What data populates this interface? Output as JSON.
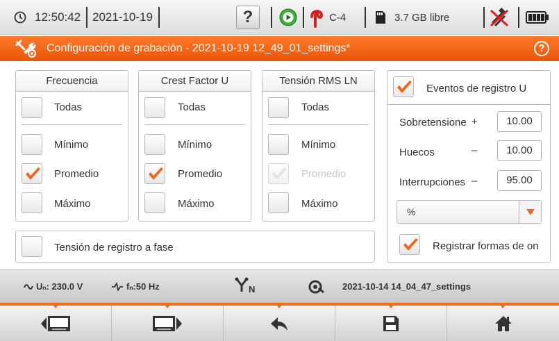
{
  "status": {
    "time": "12:50:42",
    "date": "2021-10-19",
    "help_label": "?",
    "channel": "C-4",
    "storage": "3.7 GB libre",
    "icons": [
      "clock-icon",
      "record-indicator-icon",
      "clamp-icon",
      "sd-card-icon",
      "no-network-icon",
      "battery-icon"
    ]
  },
  "title": {
    "text": "Configuración de grabación - 2021-10-19 12_49_01_settings*",
    "help_label": "?"
  },
  "panels": {
    "frecuencia": {
      "header": "Frecuencia",
      "all": "Todas",
      "min": "Mínimo",
      "avg": "Promedio",
      "max": "Máximo",
      "checked": {
        "all": false,
        "min": false,
        "avg": true,
        "max": false
      }
    },
    "crest": {
      "header": "Crest Factor U",
      "all": "Todas",
      "min": "Mínimo",
      "avg": "Promedio",
      "max": "Máximo",
      "checked": {
        "all": false,
        "min": false,
        "avg": true,
        "max": false
      }
    },
    "rms": {
      "header": "Tensión RMS LN",
      "all": "Todas",
      "min": "Mínimo",
      "avg": "Promedio",
      "max": "Máximo",
      "checked": {
        "all": false,
        "min": false,
        "avg": true,
        "max": false
      },
      "avg_disabled": true
    }
  },
  "phase_voltage": {
    "label": "Tensión de registro a fase",
    "checked": false
  },
  "events": {
    "header": "Eventos de registro U",
    "checked": true,
    "sobretension_label": "Sobretensione",
    "sobretension_sign": "+",
    "sobretension_value": "10.00",
    "huecos_label": "Huecos",
    "huecos_sign": "–",
    "huecos_value": "10.00",
    "interrupciones_label": "Interrupciones",
    "interrupciones_sign": "–",
    "interrupciones_value": "95.00",
    "unit_selected": "%",
    "waveforms_label": "Registrar formas de on",
    "waveforms_checked": true
  },
  "info": {
    "un": "Uₙ: 230.0 V",
    "fn": "fₙ:50 Hz",
    "topology": "N",
    "settings_file": "2021-10-14 14_04_47_settings"
  },
  "nav": [
    "nav-prev-screen",
    "nav-next-screen",
    "nav-back",
    "nav-save",
    "nav-home"
  ],
  "colors": {
    "accent": "#f06a1c",
    "check": "#f0681e"
  }
}
